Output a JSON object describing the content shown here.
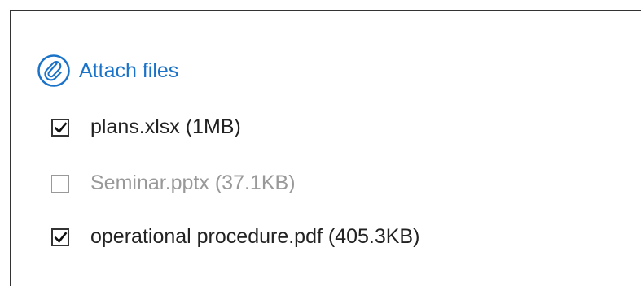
{
  "attach": {
    "label": "Attach files",
    "icon": "paperclip-circle-icon",
    "accent_color": "#1a73c8"
  },
  "files": [
    {
      "label": "plans.xlsx (1MB)",
      "checked": true,
      "disabled": false
    },
    {
      "label": "Seminar.pptx (37.1KB)",
      "checked": false,
      "disabled": true
    },
    {
      "label": "operational procedure.pdf (405.3KB)",
      "checked": true,
      "disabled": false
    }
  ]
}
